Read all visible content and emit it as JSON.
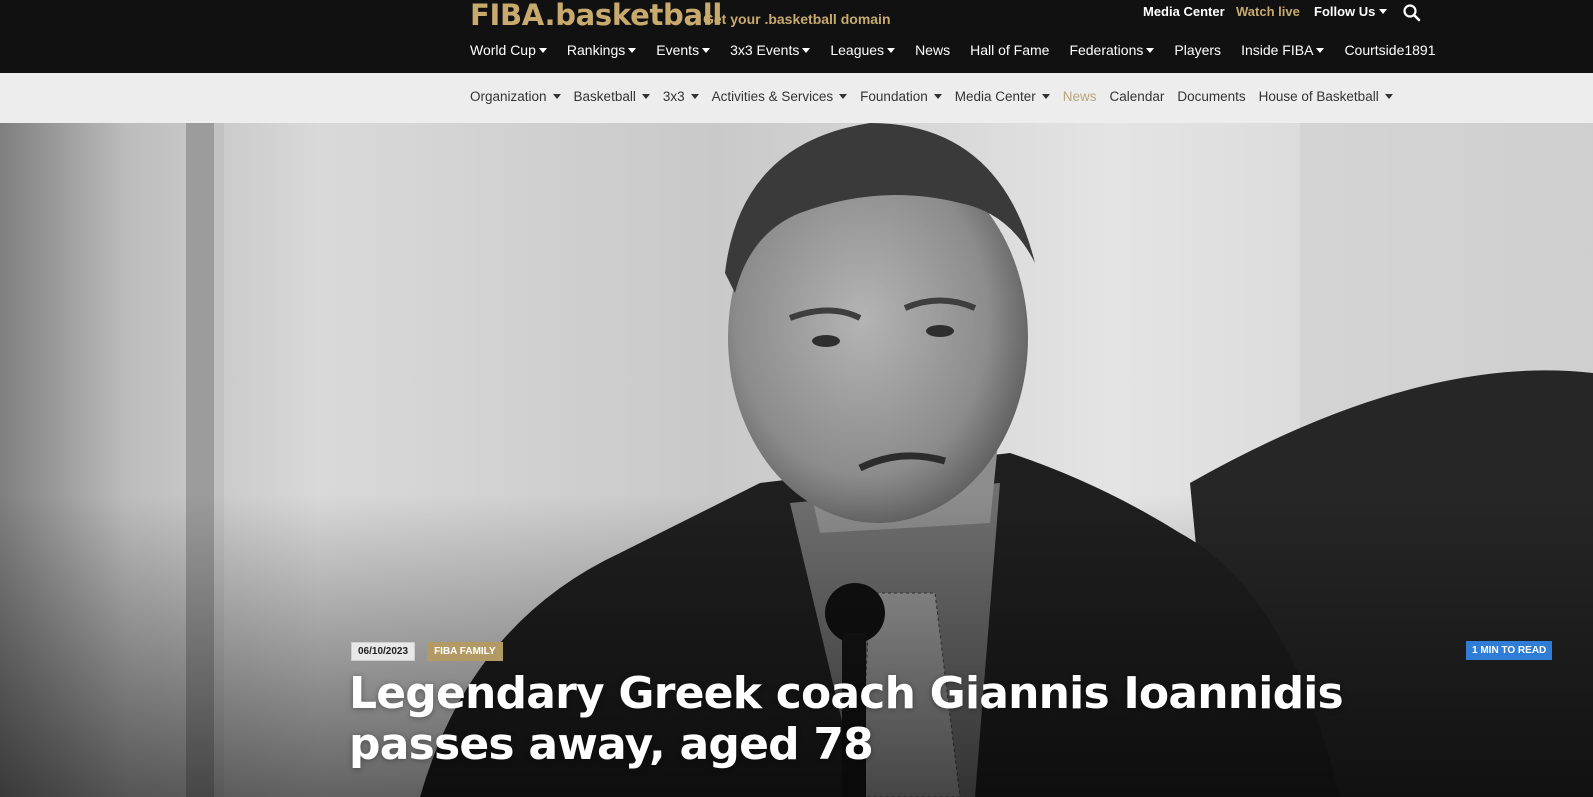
{
  "header": {
    "logo": "FIBA.basketball",
    "tagline": "Get your .basketball domain",
    "utility": {
      "media_center": "Media Center",
      "watch_live": "Watch live",
      "follow_us": "Follow Us"
    },
    "nav": [
      {
        "label": "World Cup",
        "dropdown": true
      },
      {
        "label": "Rankings",
        "dropdown": true
      },
      {
        "label": "Events",
        "dropdown": true
      },
      {
        "label": "3x3 Events",
        "dropdown": true
      },
      {
        "label": "Leagues",
        "dropdown": true
      },
      {
        "label": "News",
        "dropdown": false
      },
      {
        "label": "Hall of Fame",
        "dropdown": false
      },
      {
        "label": "Federations",
        "dropdown": true
      },
      {
        "label": "Players",
        "dropdown": false
      },
      {
        "label": "Inside FIBA",
        "dropdown": true
      },
      {
        "label": "Courtside1891",
        "dropdown": false
      }
    ]
  },
  "subnav": [
    {
      "label": "Organization",
      "dropdown": true
    },
    {
      "label": "Basketball",
      "dropdown": true
    },
    {
      "label": "3x3",
      "dropdown": true
    },
    {
      "label": "Activities & Services",
      "dropdown": true
    },
    {
      "label": "Foundation",
      "dropdown": true
    },
    {
      "label": "Media Center",
      "dropdown": true
    },
    {
      "label": "News",
      "dropdown": false,
      "active": true
    },
    {
      "label": "Calendar",
      "dropdown": false
    },
    {
      "label": "Documents",
      "dropdown": false
    },
    {
      "label": "House of Basketball",
      "dropdown": true
    }
  ],
  "article": {
    "date": "06/10/2023",
    "category": "FIBA FAMILY",
    "read_time": "1 MIN TO READ",
    "headline": "Legendary Greek coach Giannis Ioannidis passes away, aged 78"
  },
  "colors": {
    "brand_gold": "#c8aa6e",
    "header_bg": "#111111",
    "subnav_bg": "#ededed",
    "active_link": "#b9a579",
    "read_badge": "#2f7dd6"
  },
  "icons": {
    "search": "search-icon",
    "caret": "caret-down-icon"
  }
}
